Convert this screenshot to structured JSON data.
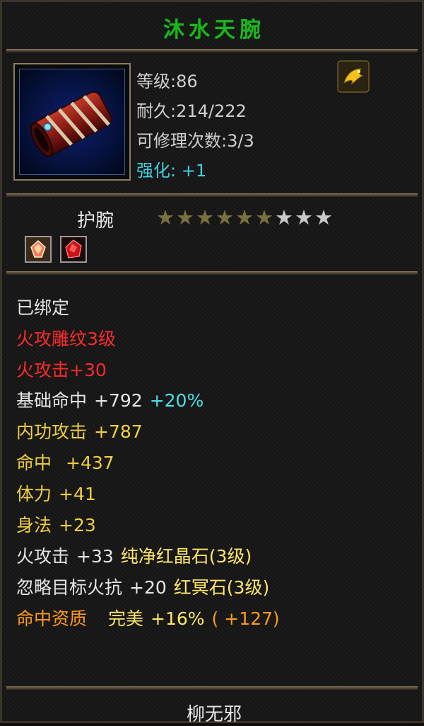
{
  "item": {
    "name": "沐水天腕",
    "level": "等级:86",
    "durability": "耐久:214/222",
    "repairs": "可修理次数:3/3",
    "enhance": "强化: +1",
    "type": "护腕",
    "stars_total": 9,
    "stars_filled": 6,
    "name_color": "#1fb41f"
  },
  "icons": {
    "item_icon": "red-bracer-icon",
    "badge": "gold-dragon-emblem-icon",
    "gems": [
      "pure-red-crystal-gem-icon",
      "red-dark-stone-gem-icon"
    ]
  },
  "stats": {
    "bound": "已绑定",
    "engrave": "火攻雕纹3级",
    "fire_attack": "火攻击+30",
    "base_hit_label": "基础命中",
    "base_hit_value": "+792",
    "base_hit_pct": "+20%",
    "internal_label": "内功攻击",
    "internal_value": "+787",
    "hit_label": "命中",
    "hit_value": "+437",
    "stamina_label": "体力",
    "stamina_value": "+41",
    "agility_label": "身法",
    "agility_value": "+23",
    "gem1_label": "火攻击",
    "gem1_value": "+33",
    "gem1_name": "纯净红晶石(3级)",
    "gem2_label": "忽略目标火抗",
    "gem2_value": "+20",
    "gem2_name": "红冥石(3级)",
    "quality_label": "命中资质",
    "quality_grade": "完美",
    "quality_value": "+16%",
    "quality_bonus": "( +127)"
  },
  "footer": {
    "owner": "柳无邪"
  }
}
